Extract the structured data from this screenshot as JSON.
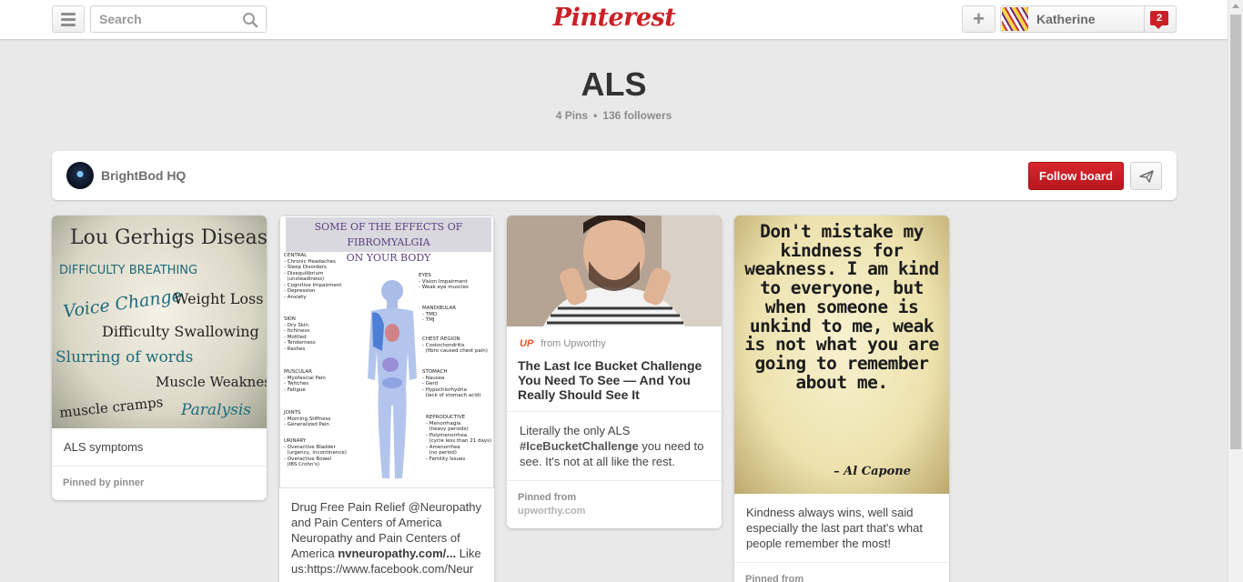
{
  "header": {
    "search_placeholder": "Search",
    "logo": "Pinterest",
    "add_symbol": "+",
    "user_name": "Katherine",
    "notification_count": "2"
  },
  "board": {
    "title": "ALS",
    "pins_count": "4 Pins",
    "separator": "•",
    "followers": "136 followers",
    "owner": "BrightBod HQ",
    "follow_label": "Follow board"
  },
  "pins": [
    {
      "image_lines": [
        "Lou Gerhigs Disease",
        "DIFFICULTY BREATHING",
        "Voice Change",
        "Weight Loss",
        "Difficulty Swallowing",
        "Slurring of words",
        "Muscle Weakness",
        "muscle cramps",
        "Paralysis"
      ],
      "description": "ALS symptoms",
      "footer": "Pinned by pinner"
    },
    {
      "image_title_1": "SOME OF THE EFFECTS OF FIBROMYALGIA",
      "image_title_2": "ON YOUR BODY",
      "image_left_lists": [
        "CENTRAL\n- Chronic Headaches\n- Sleep Disorders\n- Disequilibrium\n  (unsteadiness)\n- Cognitive Impairment\n- Depression\n- Anxiety",
        "SKIN\n- Dry Skin\n- Itchiness\n- Mottled\n- Tenderness\n- Rashes",
        "MUSCULAR\n- Myofascial Pain\n- Twitches\n- Fatigue",
        "JOINTS\n- Morning Stiffness\n- Generalized Pain",
        "URINARY\n- Overactive Bladder\n  (urgency, incontinence)\n- Overactive Bowel\n  (IBS Crohn's)"
      ],
      "image_right_lists": [
        "EYES\n- Vision Impairment\n- Weak eye muscles",
        "MANDIBULAR\n- TMD\n- TMJ",
        "CHEST REGION\n- Costochondritis\n  (fibro caused chest pain)",
        "STOMACH\n- Nausea\n- Gerd\n- Hypochlorhydria\n  (lack of stomach acid)",
        "REPRODUCTIVE\n- Menorrhagia\n  (heavy periods)\n- Polymenorrhea\n  (cycle less than 21 days)\n- Amenorrhea\n  (no period)\n- Fertility Issues"
      ],
      "description": "Drug Free Pain Relief @Neuropathy and Pain Centers of America Neuropathy and Pain Centers of America",
      "link": "nvneuropathy.com/...",
      "description_tail": "Like us:https://www.facebook.com/Neur"
    },
    {
      "source_logo": "UP",
      "source": "from Upworthy",
      "title": "The Last Ice Bucket Challenge You Need To See — And You Really Should See It",
      "description_pre": "Literally the only ALS",
      "hashtag": "#IceBucketChallenge",
      "description_post": "you need to see. It's not at all like the rest.",
      "footer": "Pinned from",
      "footer_source": "upworthy.com"
    },
    {
      "quote": "Don't mistake my kindness for weakness. I am kind to everyone, but when someone is unkind to me, weak is not what you are going to remember about me.",
      "quote_author": "– Al Capone",
      "description": "Kindness always wins, well said especially the last part that's what people remember the most!",
      "footer": "Pinned from"
    }
  ],
  "icons": {
    "menu": "menu-icon",
    "search": "search-icon",
    "plus": "plus-icon",
    "notification": "notification-icon",
    "send": "send-icon"
  },
  "colors": {
    "brand_red": "#cb2027",
    "background": "#e9e9e9",
    "upworthy_orange": "#e4542b"
  }
}
